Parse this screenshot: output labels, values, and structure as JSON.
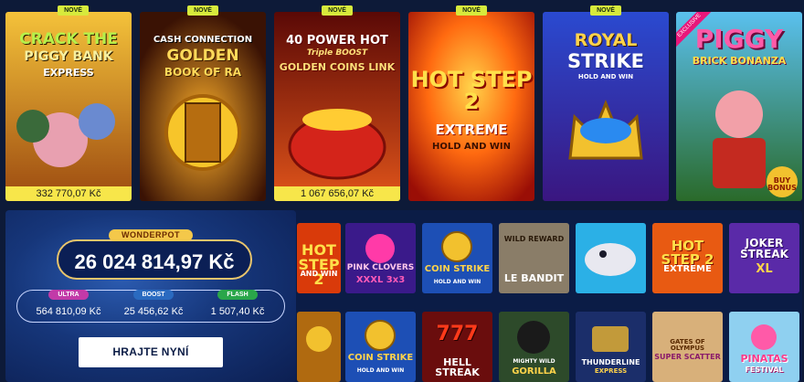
{
  "badges": {
    "new_label": "NOVÉ",
    "exclusive_label": "EXCLUSIVE"
  },
  "top_games": [
    {
      "id": "crack-the-piggy-bank",
      "line1": "CRACK THE",
      "line2": "PIGGY BANK",
      "line3": "EXPRESS",
      "jackpot": "332 770,07 Kč",
      "is_new": true,
      "colors": {
        "bg1": "#f3a520",
        "bg2": "#b05a10",
        "text": "#f7f0a0"
      }
    },
    {
      "id": "cash-connection",
      "line1": "CASH CONNECTION",
      "line2": "GOLDEN",
      "line3": "BOOK OF RA",
      "is_new": true,
      "colors": {
        "bg1": "#3b1a05",
        "bg2": "#a34a08",
        "text": "#ffd95a"
      }
    },
    {
      "id": "40-power-hot",
      "line1": "40 POWER HOT",
      "line2": "Triple BOOST",
      "line3": "GOLDEN COINS LINK",
      "jackpot": "1 067 656,07 Kč",
      "is_new": true,
      "colors": {
        "bg1": "#6a0b08",
        "bg2": "#c73010",
        "text": "#ffe07a"
      }
    },
    {
      "id": "hot-step-2",
      "line1": "HOT STEP 2",
      "line2": "EXTREME",
      "line3": "HOLD AND WIN",
      "is_new": true,
      "colors": {
        "bg1": "#ff7a1a",
        "bg2": "#c2180a",
        "text": "#fff"
      }
    },
    {
      "id": "royal-strike",
      "line1": "ROYAL",
      "line2": "STRIKE",
      "line3": "HOLD AND WIN",
      "is_new": true,
      "colors": {
        "bg1": "#1f3fb0",
        "bg2": "#4a1d8a",
        "text": "#ffd34a"
      }
    },
    {
      "id": "piggy-brick-bonanza",
      "line1": "PIGGY",
      "line2": "BRICK BONANZA",
      "line3": "BUY BONUS",
      "exclusive": true,
      "colors": {
        "bg1": "#4fb4e8",
        "bg2": "#2a7a30",
        "text": "#ff5aa8"
      }
    }
  ],
  "wonderpot": {
    "title": "WONDERPOT",
    "amount": "26 024 814,97 Kč",
    "tiers": [
      {
        "label": "ULTRA",
        "value": "564 810,09 Kč",
        "color": "#c23aa8"
      },
      {
        "label": "BOOST",
        "value": "25 456,62 Kč",
        "color": "#2a6ac0"
      },
      {
        "label": "FLASH",
        "value": "1 507,40 Kč",
        "color": "#2aa64a"
      }
    ],
    "cta": "HRAJTE NYNÍ"
  },
  "grid_games": [
    {
      "id": "hot-step-2-small",
      "label": "HOT STEP 2",
      "sub": "AND WIN",
      "bg": "#d93a0a"
    },
    {
      "id": "pink-clovers",
      "label": "PINK CLOVERS",
      "sub": "XXXL 3x3",
      "bg": "#3a1a8a"
    },
    {
      "id": "coin-strike-1",
      "label": "COIN STRIKE",
      "sub": "HOLD AND WIN",
      "bg": "#1d4fb5"
    },
    {
      "id": "le-bandit",
      "label": "WILD REWARD",
      "sub": "LE BANDIT",
      "bg": "#8a7d68"
    },
    {
      "id": "shark-game",
      "label": "",
      "sub": "",
      "bg": "#2bb0e6"
    },
    {
      "id": "hot-step-2-extreme",
      "label": "HOT STEP 2",
      "sub": "EXTREME",
      "bg": "#e85a12"
    },
    {
      "id": "joker-streak",
      "label": "JOKER STREAK",
      "sub": "XL",
      "bg": "#5a2aa8"
    },
    {
      "id": "fortune-small",
      "label": "",
      "sub": "",
      "bg": "#b06a10"
    },
    {
      "id": "coin-strike-2",
      "label": "COIN STRIKE",
      "sub": "HOLD AND WIN",
      "bg": "#1d4fb5"
    },
    {
      "id": "hell-streak",
      "label": "777",
      "sub": "HELL STREAK",
      "bg": "#6a0d0d"
    },
    {
      "id": "mighty-wild-gorilla",
      "label": "MIGHTY WILD",
      "sub": "GORILLA",
      "bg": "#2d4a2a"
    },
    {
      "id": "thunderline-express",
      "label": "THUNDERLINE",
      "sub": "EXPRESS",
      "bg": "#1b2e6a"
    },
    {
      "id": "gates-of-olympus",
      "label": "GATES OF OLYMPUS",
      "sub": "SUPER SCATTER",
      "bg": "#d8b07a"
    },
    {
      "id": "pinatas-festival",
      "label": "PINATAS",
      "sub": "FESTIVAL",
      "bg": "#8fd0f0"
    }
  ]
}
